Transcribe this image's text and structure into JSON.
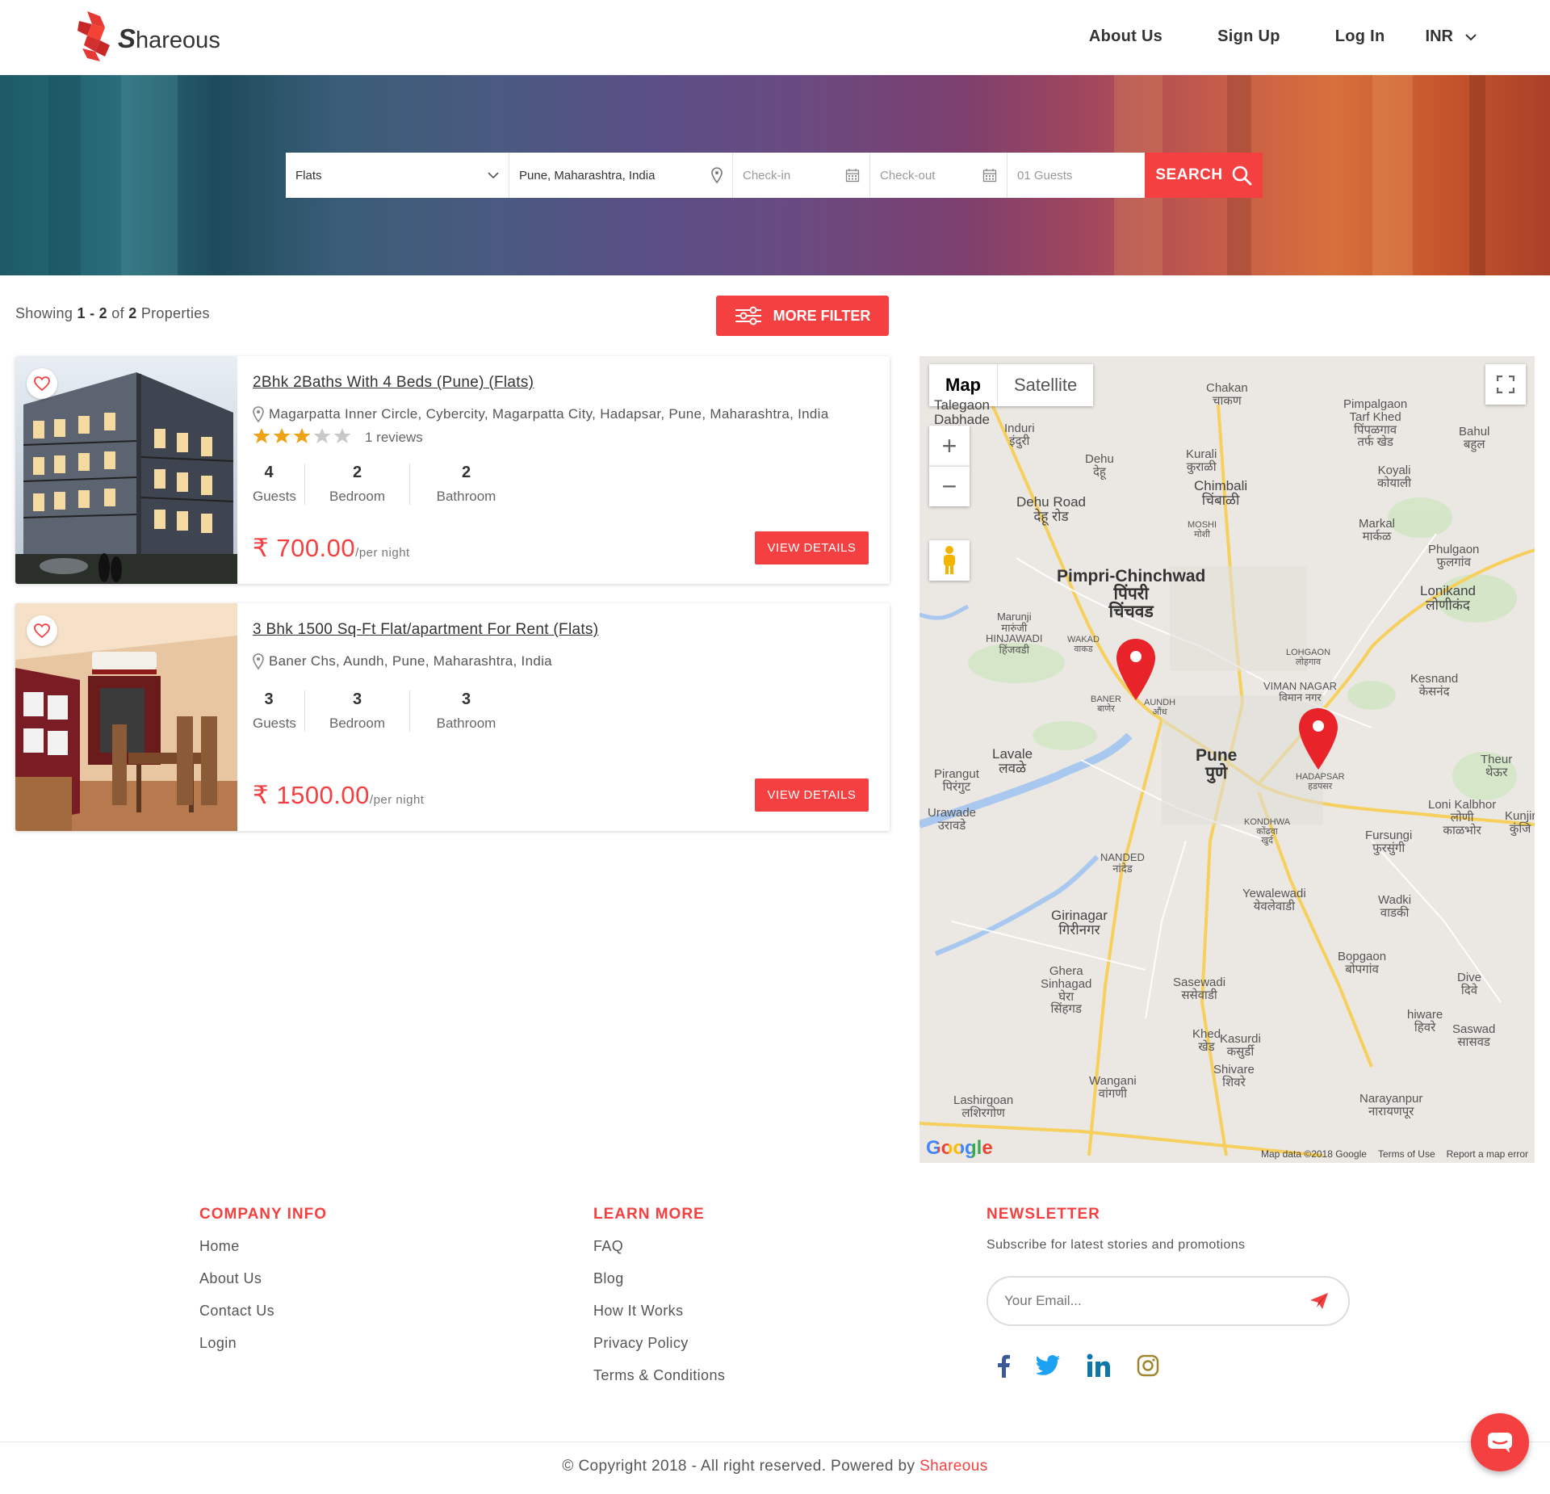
{
  "brand": {
    "name_initial": "S",
    "name_rest": "hareous",
    "accent": "#f44040"
  },
  "nav": {
    "about": "About Us",
    "signup": "Sign Up",
    "login": "Log In",
    "currency": "INR"
  },
  "search": {
    "type": "Flats",
    "location": "Pune, Maharashtra, India",
    "checkin_placeholder": "Check-in",
    "checkout_placeholder": "Check-out",
    "guests": "01 Guests",
    "button": "SEARCH"
  },
  "results": {
    "prefix": "Showing ",
    "range_start": "1",
    "dash": " - ",
    "range_end": "2",
    "of": " of ",
    "total": "2",
    "suffix": " Properties",
    "more_filter": "MORE FILTER"
  },
  "listings": [
    {
      "title": "2Bhk 2Baths With 4 Beds (Pune) (Flats)",
      "address": "Magarpatta Inner Circle, Cybercity, Magarpatta City, Hadapsar, Pune, Maharashtra, India",
      "rating": 3,
      "rating_max": 5,
      "reviews": "1 reviews",
      "guests": "4",
      "guests_label": "Guests",
      "bedroom": "2",
      "bedroom_label": "Bedroom",
      "bathroom": "2",
      "bathroom_label": "Bathroom",
      "price": "₹ 700.00",
      "per": "/per night",
      "button": "VIEW DETAILS"
    },
    {
      "title": "3 Bhk 1500 Sq-Ft Flat/apartment For Rent (Flats)",
      "address": "Baner Chs, Aundh, Pune, Maharashtra, India",
      "guests": "3",
      "guests_label": "Guests",
      "bedroom": "3",
      "bedroom_label": "Bedroom",
      "bathroom": "3",
      "bathroom_label": "Bathroom",
      "price": "₹ 1500.00",
      "per": "/per night",
      "button": "VIEW DETAILS"
    }
  ],
  "map": {
    "tab_map": "Map",
    "tab_satellite": "Satellite",
    "zoom_in": "+",
    "zoom_out": "−",
    "attribution": "Map data ©2018 Google",
    "terms": "Terms of Use",
    "report": "Report a map error",
    "google": "Google",
    "labels": {
      "chakan": "Chakan\nचाकण",
      "talegaon": "Talegaon\nDabhade",
      "induri": "Induri\nइंदुरी",
      "dehu": "Dehu\nदेहू",
      "kurali": "Kurali\nकुराळी",
      "chimbali": "Chimbali\nचिंबाळी",
      "pimpalgaon": "Pimpalgaon\nTarf Khed\nपिंपळगाव\nतर्फ खेड",
      "bahul": "Bahul\nबहुल",
      "koyali": "Koyali\nकोयाली",
      "dehu_road": "Dehu Road\nदेहू रोड",
      "moshi": "MOSHI\nमोशी",
      "markal": "Markal\nमार्कळ",
      "phulgaon": "Phulgaon\nफुलगांव",
      "pimpri": "Pimpri-Chinchwad\nपिंपरी\nचिंचवड",
      "lonikand": "Lonikand\nलोणीकंद",
      "marunji": "Marunji\nमारुंजी\nHINJAWADI\nहिंजवडी",
      "wakad": "WAKAD\nवाकड",
      "lohgaon": "LOHGAON\nलोहगाव",
      "viman": "VIMAN NAGAR\nविमान नगर",
      "kesnand": "Kesnand\nकेसनंद",
      "baner": "BANER\nबाणेर",
      "aundh": "AUNDH\nऔंध",
      "lavale": "Lavale\nलवळे",
      "pune": "Pune\nपुणे",
      "hadapsar": "HADAPSAR\nहडपसर",
      "theur": "Theur\nथेऊर",
      "pirangut": "Pirangut\nपिरंगुट",
      "urawade": "Urawade\nउरावडे",
      "kondhwa": "KONDHWA\nकोंढवा\nखुर्द",
      "loni": "Loni Kalbhor\nलोणी\nकाळभोर",
      "fursungi": "Fursungi\nफुरसुंगी",
      "nanded": "NANDED\nनांदेड",
      "yewalewadi": "Yewalewadi\nयेवलेवाडी",
      "wadki": "Wadki\nवाडकी",
      "girinagar": "Girinagar\nगिरीनगर",
      "bopgaon": "Bopgaon\nबोपगांव",
      "ghera": "Ghera\nSinhagad\nघेरा\nसिंहगड",
      "sasewadi": "Sasewadi\nससेवाडी",
      "dive": "Dive\nदिवे",
      "hiware": "hiware\nहिवरे",
      "saswad": "Saswad\nसासवड",
      "khed": "Khed\nखेड",
      "kasurdi": "Kasurdi\nकसुर्डी",
      "shivare": "Shivare\nशिवरे",
      "wangani": "Wangani\nवांगणी",
      "lashirgoan": "Lashirgoan\nलशिरगोण",
      "narayanpur": "Narayanpur\nनारायणपूर",
      "kunjir": "Kunjir\nकुंजि"
    }
  },
  "footer": {
    "company": {
      "title": "COMPANY INFO",
      "links": [
        "Home",
        "About Us",
        "Contact Us",
        "Login"
      ]
    },
    "learn": {
      "title": "LEARN MORE",
      "links": [
        "FAQ",
        "Blog",
        "How It Works",
        "Privacy Policy",
        "Terms & Conditions"
      ]
    },
    "newsletter": {
      "title": "NEWSLETTER",
      "text": "Subscribe for latest stories and promotions",
      "placeholder": "Your Email..."
    },
    "social": [
      "facebook-icon",
      "twitter-icon",
      "linkedin-icon",
      "instagram-icon"
    ],
    "copyright": "© Copyright 2018 - All right reserved. Powered by ",
    "powered_by": "Shareous"
  }
}
